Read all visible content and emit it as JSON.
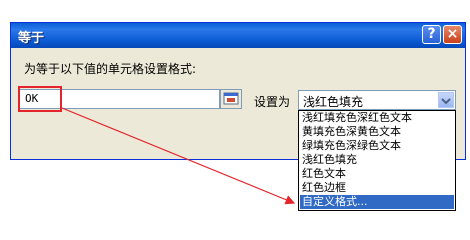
{
  "dialog": {
    "title": "等于",
    "help_glyph": "?",
    "close_glyph": "×",
    "instruction": "为等于以下值的单元格设置格式:",
    "value": "OK",
    "set_as_label": "设置为",
    "selected_format": "浅红色填充",
    "format_options": [
      "浅红填充色深红色文本",
      "黄填充色深黄色文本",
      "绿填充色深绿色文本",
      "浅红色填充",
      "红色文本",
      "红色边框",
      "自定义格式..."
    ],
    "highlighted_option_index": 6
  },
  "icons": {
    "help": "help-icon",
    "close": "close-icon",
    "collapse": "collapse-dialog-icon",
    "dropdown": "chevron-down-icon"
  },
  "colors": {
    "titlebar": "#0a58d0",
    "dialog_bg": "#ece9d8",
    "highlight": "#e3242b",
    "selection": "#316ac5"
  }
}
